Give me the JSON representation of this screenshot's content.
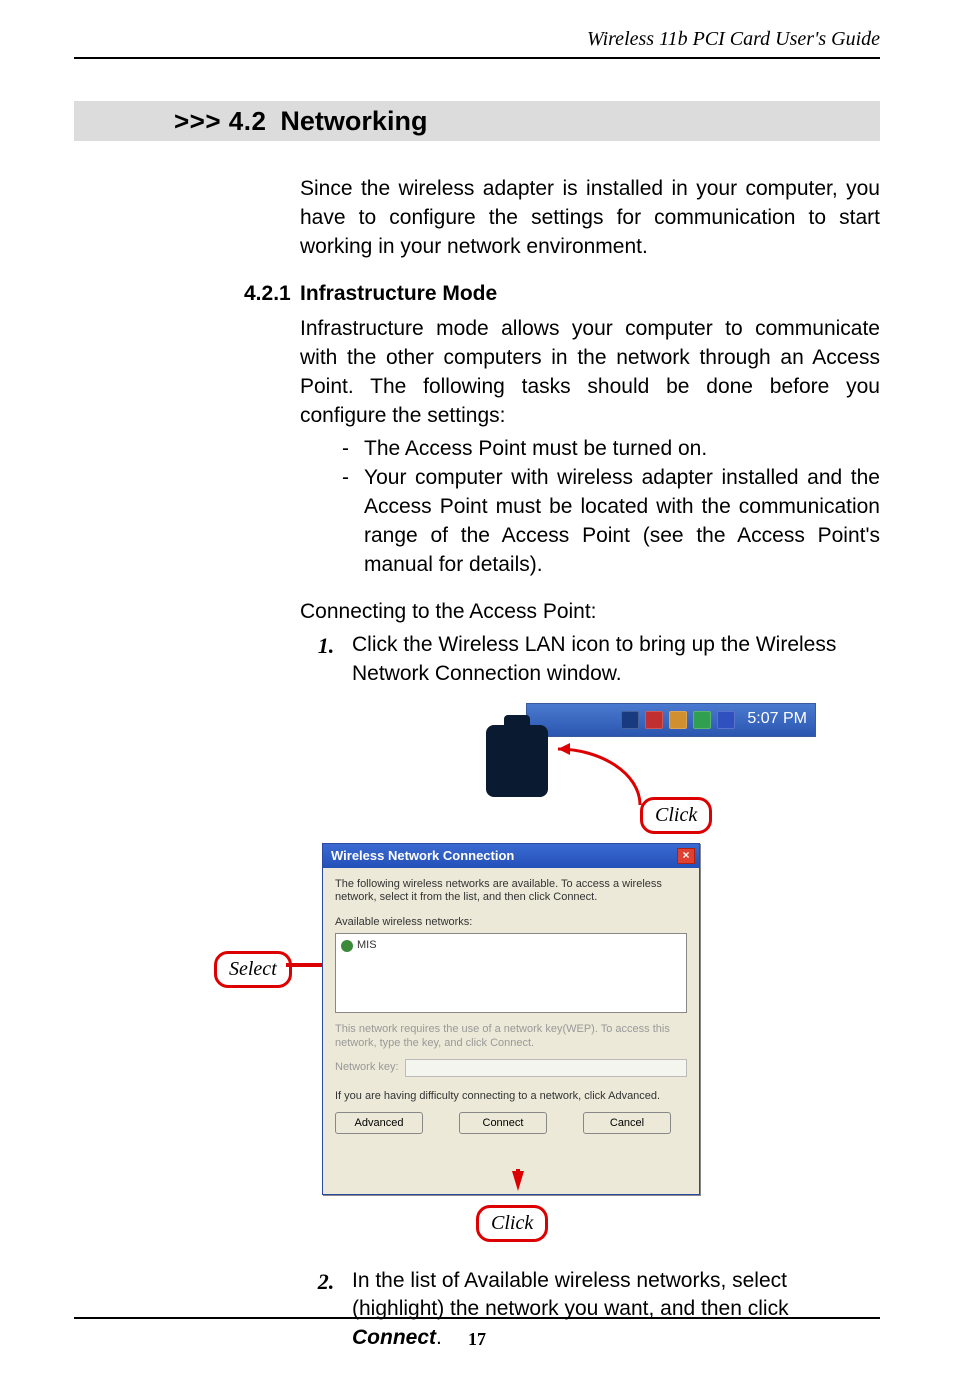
{
  "running_head": "Wireless 11b PCI Card User's Guide",
  "section": {
    "prefix": ">>> 4.2",
    "title": "Networking"
  },
  "intro": "Since the wireless adapter is installed in your computer, you have to configure the settings for communication to start working in your network environment.",
  "subsection": {
    "num": "4.2.1",
    "title": "Infrastructure Mode"
  },
  "infra_para": "Infrastructure mode allows your computer to communicate with the other computers in the network through an Access Point.  The following tasks should be done before you configure the settings:",
  "bullets": [
    "The Access Point must be turned on.",
    "Your computer with wireless adapter installed and the Access Point must be located with the communication range of the Access Point (see the Access Point's manual for details)."
  ],
  "connect_head": "Connecting to the Access Point:",
  "steps": [
    {
      "n": "1.",
      "text": "Click the Wireless LAN icon to bring up the Wireless Network Connection window."
    },
    {
      "n": "2.",
      "text_a": "In the list of Available wireless networks, select (highlight) the network you want, and then click ",
      "bold": "Connect",
      "text_b": "."
    }
  ],
  "tray": {
    "clock": "5:07 PM"
  },
  "callouts": {
    "click": "Click",
    "select": "Select"
  },
  "dialog": {
    "title": "Wireless Network Connection",
    "desc": "The following wireless networks are available. To access a wireless network, select it from the list, and then click Connect.",
    "avail_label": "Available wireless networks:",
    "item": "MIS",
    "wep_note": "This network requires the use of a network key(WEP). To access this network, type the key, and click Connect.",
    "key_label": "Network key:",
    "adv_note": "If you are having difficulty connecting to a network, click Advanced.",
    "buttons": {
      "advanced": "Advanced",
      "connect": "Connect",
      "cancel": "Cancel"
    }
  },
  "page_number": "17"
}
